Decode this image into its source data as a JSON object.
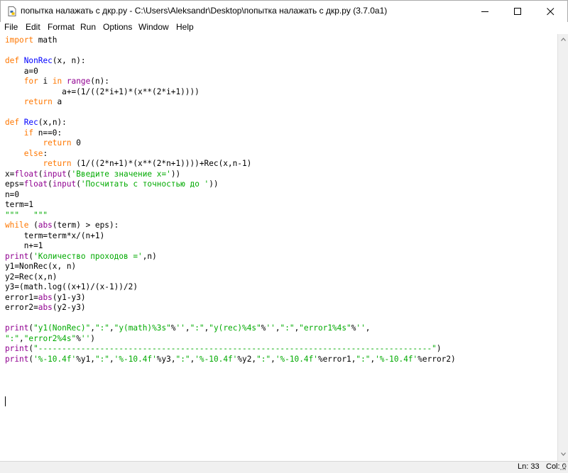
{
  "window": {
    "title": "попытка налажать с дкр.py - C:\\Users\\Aleksandr\\Desktop\\попытка налажать с дкр.py (3.7.0a1)",
    "controls": {
      "minimize": "minimize-icon",
      "maximize": "maximize-icon",
      "close": "close-icon"
    }
  },
  "menu": {
    "items": [
      "File",
      "Edit",
      "Format",
      "Run",
      "Options",
      "Window",
      "Help"
    ]
  },
  "icons": {
    "app": "python-file-icon",
    "scroll_up": "chevron-up-icon",
    "scroll_down": "chevron-down-icon"
  },
  "colors": {
    "keyword": "#ff7700",
    "builtin": "#900090",
    "definition": "#0000ff",
    "string": "#00aa00"
  },
  "code": {
    "lines": [
      [
        [
          "kw",
          "import"
        ],
        [
          "nm",
          " math"
        ]
      ],
      [],
      [
        [
          "kw",
          "def"
        ],
        [
          "nm",
          " "
        ],
        [
          "def",
          "NonRec"
        ],
        [
          "nm",
          "(x, n):"
        ]
      ],
      [
        [
          "nm",
          "    a=0"
        ]
      ],
      [
        [
          "nm",
          "    "
        ],
        [
          "kw",
          "for"
        ],
        [
          "nm",
          " i "
        ],
        [
          "kw",
          "in"
        ],
        [
          "nm",
          " "
        ],
        [
          "bi",
          "range"
        ],
        [
          "nm",
          "(n):"
        ]
      ],
      [
        [
          "nm",
          "            a+=(1/((2*i+1)*(x**(2*i+1))))"
        ]
      ],
      [
        [
          "nm",
          "    "
        ],
        [
          "kw",
          "return"
        ],
        [
          "nm",
          " a"
        ]
      ],
      [],
      [
        [
          "kw",
          "def"
        ],
        [
          "nm",
          " "
        ],
        [
          "def",
          "Rec"
        ],
        [
          "nm",
          "(x,n):"
        ]
      ],
      [
        [
          "nm",
          "    "
        ],
        [
          "kw",
          "if"
        ],
        [
          "nm",
          " n==0:"
        ]
      ],
      [
        [
          "nm",
          "        "
        ],
        [
          "kw",
          "return"
        ],
        [
          "nm",
          " 0"
        ]
      ],
      [
        [
          "nm",
          "    "
        ],
        [
          "kw",
          "else"
        ],
        [
          "nm",
          ":"
        ]
      ],
      [
        [
          "nm",
          "        "
        ],
        [
          "kw",
          "return"
        ],
        [
          "nm",
          " (1/((2*n+1)*(x**(2*n+1))))+Rec(x,n-1)"
        ]
      ],
      [
        [
          "nm",
          "x="
        ],
        [
          "bi",
          "float"
        ],
        [
          "nm",
          "("
        ],
        [
          "bi",
          "input"
        ],
        [
          "nm",
          "("
        ],
        [
          "str",
          "'Введите значение x='"
        ],
        [
          "nm",
          "))"
        ]
      ],
      [
        [
          "nm",
          "eps="
        ],
        [
          "bi",
          "float"
        ],
        [
          "nm",
          "("
        ],
        [
          "bi",
          "input"
        ],
        [
          "nm",
          "("
        ],
        [
          "str",
          "'Посчитать с точностью до '"
        ],
        [
          "nm",
          "))"
        ]
      ],
      [
        [
          "nm",
          "n=0"
        ]
      ],
      [
        [
          "nm",
          "term=1"
        ]
      ],
      [
        [
          "str",
          "\"\"\"   \"\"\""
        ]
      ],
      [
        [
          "kw",
          "while"
        ],
        [
          "nm",
          " ("
        ],
        [
          "bi",
          "abs"
        ],
        [
          "nm",
          "(term) > eps):"
        ]
      ],
      [
        [
          "nm",
          "    term=term*x/(n+1)"
        ]
      ],
      [
        [
          "nm",
          "    n+=1"
        ]
      ],
      [
        [
          "bi",
          "print"
        ],
        [
          "nm",
          "("
        ],
        [
          "str",
          "'Количество проходов ='"
        ],
        [
          "nm",
          ",n)"
        ]
      ],
      [
        [
          "nm",
          "y1=NonRec(x, n)"
        ]
      ],
      [
        [
          "nm",
          "y2=Rec(x,n)"
        ]
      ],
      [
        [
          "nm",
          "y3=(math.log((x+1)/(x-1))/2)"
        ]
      ],
      [
        [
          "nm",
          "error1="
        ],
        [
          "bi",
          "abs"
        ],
        [
          "nm",
          "(y1-y3)"
        ]
      ],
      [
        [
          "nm",
          "error2="
        ],
        [
          "bi",
          "abs"
        ],
        [
          "nm",
          "(y2-y3)"
        ]
      ],
      [],
      [
        [
          "bi",
          "print"
        ],
        [
          "nm",
          "("
        ],
        [
          "str",
          "\"y1(NonRec)\""
        ],
        [
          "nm",
          ","
        ],
        [
          "str",
          "\":\""
        ],
        [
          "nm",
          ","
        ],
        [
          "str",
          "\"y(math)%3s\""
        ],
        [
          "nm",
          "%"
        ],
        [
          "str",
          "''"
        ],
        [
          "nm",
          ","
        ],
        [
          "str",
          "\":\""
        ],
        [
          "nm",
          ","
        ],
        [
          "str",
          "\"y(rec)%4s\""
        ],
        [
          "nm",
          "%"
        ],
        [
          "str",
          "''"
        ],
        [
          "nm",
          ","
        ],
        [
          "str",
          "\":\""
        ],
        [
          "nm",
          ","
        ],
        [
          "str",
          "\"error1%4s\""
        ],
        [
          "nm",
          "%"
        ],
        [
          "str",
          "''"
        ],
        [
          "nm",
          ","
        ]
      ],
      [
        [
          "str",
          "\":\""
        ],
        [
          "nm",
          ","
        ],
        [
          "str",
          "\"error2%4s\""
        ],
        [
          "nm",
          "%"
        ],
        [
          "str",
          "''"
        ],
        [
          "nm",
          ")"
        ]
      ],
      [
        [
          "bi",
          "print"
        ],
        [
          "nm",
          "("
        ],
        [
          "str",
          "\"-----------------------------------------------------------------------------------\""
        ],
        [
          "nm",
          ")"
        ]
      ],
      [
        [
          "bi",
          "print"
        ],
        [
          "nm",
          "("
        ],
        [
          "str",
          "'%-10.4f'"
        ],
        [
          "nm",
          "%y1,"
        ],
        [
          "str",
          "\":\""
        ],
        [
          "nm",
          ","
        ],
        [
          "str",
          "'%-10.4f'"
        ],
        [
          "nm",
          "%y3,"
        ],
        [
          "str",
          "\":\""
        ],
        [
          "nm",
          ","
        ],
        [
          "str",
          "'%-10.4f'"
        ],
        [
          "nm",
          "%y2,"
        ],
        [
          "str",
          "\":\""
        ],
        [
          "nm",
          ","
        ],
        [
          "str",
          "'%-10.4f'"
        ],
        [
          "nm",
          "%error1,"
        ],
        [
          "str",
          "\":\""
        ],
        [
          "nm",
          ","
        ],
        [
          "str",
          "'%-10.4f'"
        ],
        [
          "nm",
          "%error2)"
        ]
      ]
    ]
  },
  "status": {
    "ln": "Ln: 33",
    "col": "Col: 0"
  }
}
